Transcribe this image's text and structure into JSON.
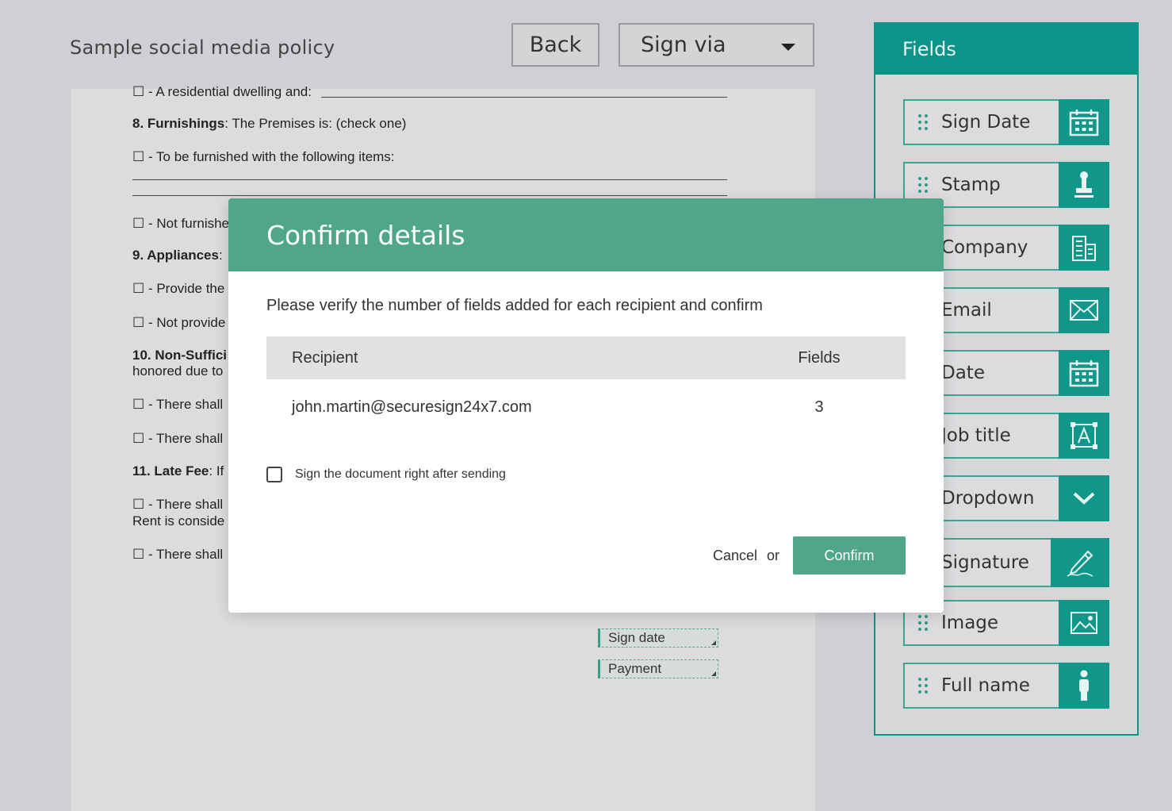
{
  "header": {
    "doc_title": "Sample social media policy",
    "back_label": "Back",
    "signvia_label": "Sign via"
  },
  "document": {
    "lines": [
      "☐ - A residential dwelling and:",
      "8. Furnishings",
      ": The Premises is: (check one)",
      "☐ - To be furnished with the following items:",
      "☐ - Not furnishe",
      "9. Appliances",
      ":",
      "☐ - Provide the",
      "☐ - Not provide",
      "10. Non-Suffici",
      "honored due to",
      "☐ - There shall",
      "☐ - There shall",
      "11. Late Fee",
      ": If",
      "☐ - There shall",
      "Rent is conside",
      "☐ - There shall"
    ],
    "placed_fields": [
      "Sign date",
      "Payment"
    ]
  },
  "panel": {
    "title": "Fields",
    "items": [
      {
        "label": "Sign Date",
        "icon": "calendar-icon"
      },
      {
        "label": "Stamp",
        "icon": "stamp-icon"
      },
      {
        "label": "Company",
        "icon": "building-icon"
      },
      {
        "label": "Email",
        "icon": "envelope-icon"
      },
      {
        "label": "Date",
        "icon": "calendar-icon"
      },
      {
        "label": "Job title",
        "icon": "text-box-icon"
      },
      {
        "label": "Dropdown",
        "icon": "chevron-down-icon"
      },
      {
        "label": "Signature",
        "icon": "pen-icon"
      },
      {
        "label": "Image",
        "icon": "image-icon"
      },
      {
        "label": "Full name",
        "icon": "person-icon"
      }
    ]
  },
  "modal": {
    "title": "Confirm details",
    "description": "Please verify the number of fields added for each recipient and confirm",
    "table": {
      "headers": [
        "Recipient",
        "Fields"
      ],
      "rows": [
        {
          "recipient": "john.martin@securesign24x7.com",
          "fields": "3"
        }
      ]
    },
    "checkbox_label": "Sign the document right after sending",
    "checkbox_checked": false,
    "cancel_label": "Cancel",
    "or_label": "or",
    "confirm_label": "Confirm"
  },
  "colors": {
    "panel_teal": "#0d9488",
    "modal_green": "#4fa68a",
    "background": "#cfcfd4"
  }
}
